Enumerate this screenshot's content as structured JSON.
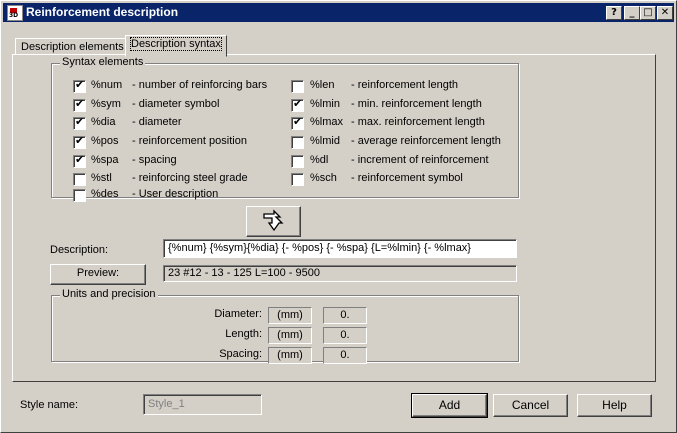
{
  "window": {
    "title": "Reinforcement description",
    "help_glyph": "?",
    "minimize_glyph": "_",
    "maximize_glyph": "□",
    "close_glyph": "✕"
  },
  "tabs": [
    {
      "label": "Description elements"
    },
    {
      "label": "Description syntax"
    }
  ],
  "syntax_elements": {
    "legend": "Syntax elements",
    "left": [
      {
        "code": "%num",
        "desc": "- number of reinforcing bars",
        "checked": true
      },
      {
        "code": "%sym",
        "desc": "- diameter symbol",
        "checked": true
      },
      {
        "code": "%dia",
        "desc": "- diameter",
        "checked": true
      },
      {
        "code": "%pos",
        "desc": "- reinforcement position",
        "checked": true
      },
      {
        "code": "%spa",
        "desc": "- spacing",
        "checked": true
      },
      {
        "code": "%stl",
        "desc": "- reinforcing steel grade",
        "checked": false
      },
      {
        "code": "%des",
        "desc": "- User description",
        "checked": false
      }
    ],
    "right": [
      {
        "code": "%len",
        "desc": "- reinforcement length",
        "checked": false
      },
      {
        "code": "%lmin",
        "desc": "- min. reinforcement length",
        "checked": true
      },
      {
        "code": "%lmax",
        "desc": "- max. reinforcement length",
        "checked": true
      },
      {
        "code": "%lmid",
        "desc": "- average reinforcement length",
        "checked": false
      },
      {
        "code": "%dl",
        "desc": "- increment of reinforcement",
        "checked": false
      },
      {
        "code": "%sch",
        "desc": "- reinforcement symbol",
        "checked": false
      }
    ]
  },
  "description": {
    "label": "Description:",
    "value": "{%num} {%sym}{%dia} {- %pos} {- %spa}  {L=%lmin} {- %lmax}"
  },
  "preview": {
    "button_label": "Preview:",
    "value": "23 #12 - 13 - 125  L=100 - 9500"
  },
  "units": {
    "legend": "Units and precision",
    "rows": [
      {
        "label": "Diameter:",
        "unit": "(mm)",
        "precision": "0."
      },
      {
        "label": "Length:",
        "unit": "(mm)",
        "precision": "0."
      },
      {
        "label": "Spacing:",
        "unit": "(mm)",
        "precision": "0."
      }
    ]
  },
  "style": {
    "label": "Style name:",
    "value": "Style_1"
  },
  "buttons": {
    "add": "Add",
    "cancel": "Cancel",
    "help": "Help"
  }
}
